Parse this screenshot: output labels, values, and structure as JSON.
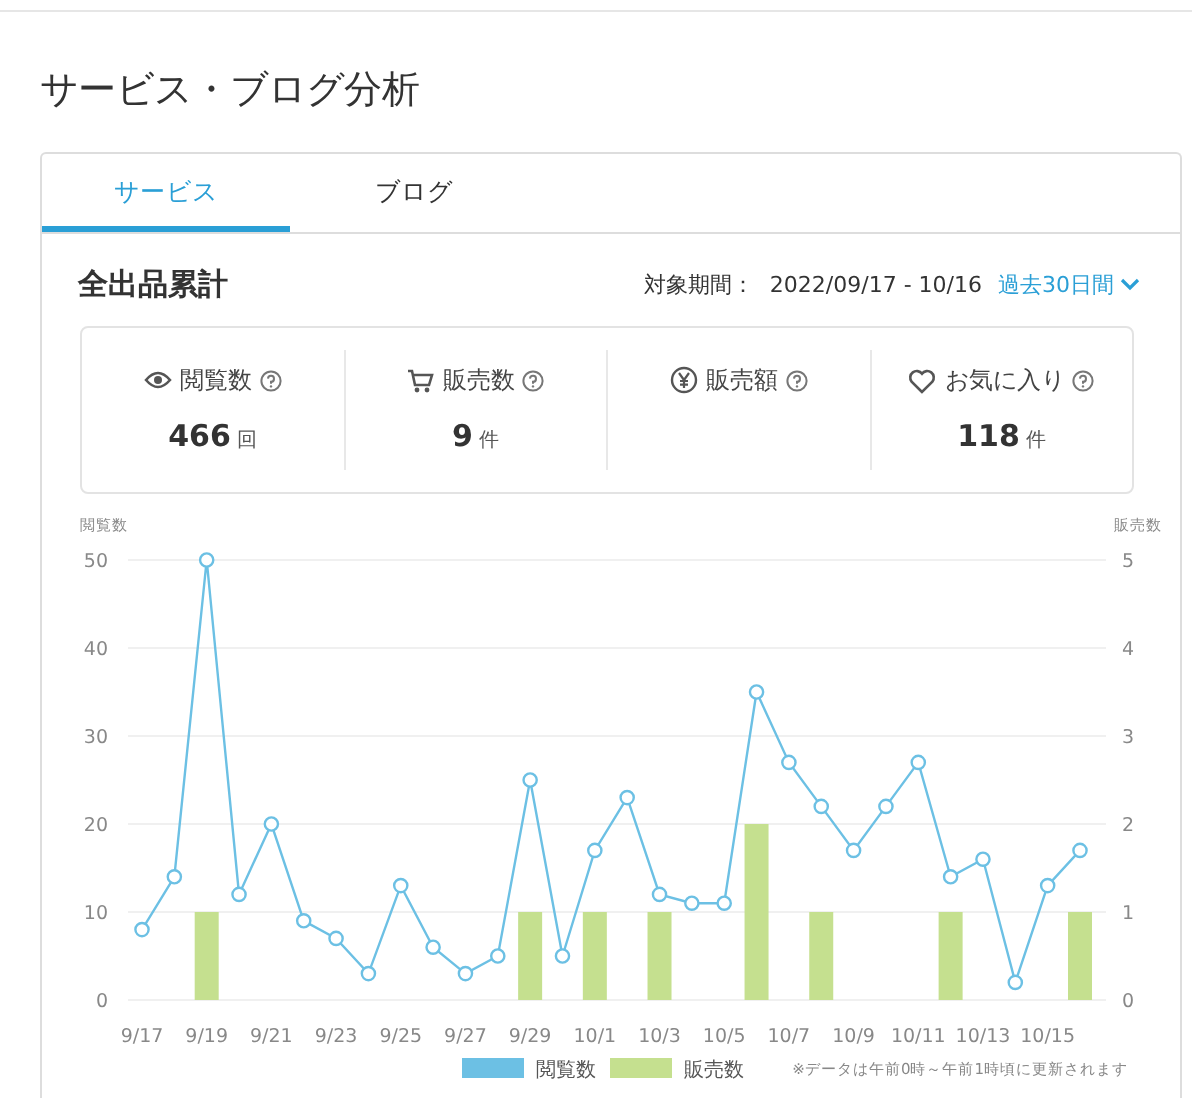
{
  "page_title": "サービス・ブログ分析",
  "tabs": [
    {
      "label": "サービス",
      "selected": true
    },
    {
      "label": "ブログ",
      "selected": false
    }
  ],
  "section": {
    "title": "全出品累計",
    "period_label": "対象期間：",
    "period": "2022/09/17 - 10/16",
    "range_select": "過去30日間"
  },
  "stats": [
    {
      "kind": "eye",
      "label": "閲覧数",
      "value": "466",
      "unit": "回"
    },
    {
      "kind": "cart",
      "label": "販売数",
      "value": "9",
      "unit": "件"
    },
    {
      "kind": "yen",
      "label": "販売額"
    },
    {
      "kind": "heart",
      "label": "お気に入り",
      "value": "118",
      "unit": "件"
    }
  ],
  "chart": {
    "chart_data": {
      "type": "line",
      "grid": true,
      "legend": "bottom",
      "ylabel": "閲覧数",
      "y2label": "販売数",
      "ylim": [
        0,
        50
      ],
      "y2lim": [
        0,
        5
      ],
      "yticks": [
        0,
        10,
        20,
        30,
        40,
        50
      ],
      "y2ticks": [
        0,
        1,
        2,
        3,
        4,
        5
      ],
      "categories": [
        "9/17",
        null,
        "9/19",
        null,
        "9/21",
        null,
        "9/23",
        null,
        "9/25",
        null,
        "9/27",
        null,
        "9/29",
        null,
        "10/1",
        null,
        "10/3",
        null,
        "10/5",
        null,
        "10/7",
        null,
        "10/9",
        null,
        "10/11",
        null,
        "10/13",
        null,
        "10/15",
        null
      ],
      "series": [
        {
          "name": "閲覧数",
          "marker": "circle",
          "color": "#6cc0e4",
          "values": [
            8,
            14,
            50,
            12,
            20,
            9,
            7,
            3,
            13,
            6,
            3,
            5,
            25,
            5,
            17,
            23,
            12,
            11,
            11,
            35,
            27,
            22,
            17,
            22,
            27,
            14,
            16,
            2,
            13,
            17
          ]
        },
        {
          "name": "販売数",
          "type": "bar",
          "axis": "y2",
          "color": "#c5e08f",
          "values": [
            0,
            0,
            1,
            0,
            0,
            0,
            0,
            0,
            0,
            0,
            0,
            0,
            1,
            0,
            1,
            0,
            1,
            0,
            0,
            2,
            0,
            1,
            0,
            0,
            0,
            1,
            0,
            0,
            0,
            1
          ]
        }
      ]
    },
    "note": "※データは午前0時～午前1時頃に更新されます"
  }
}
